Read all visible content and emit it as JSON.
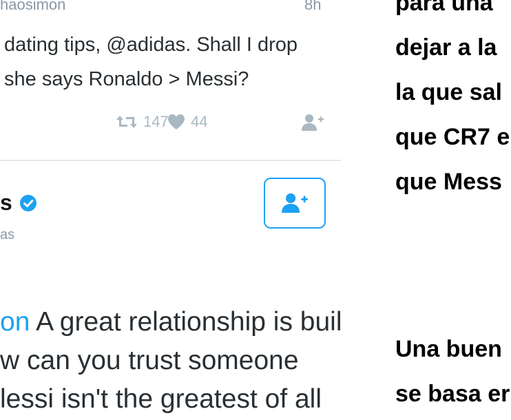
{
  "reply": {
    "handle": "haosimon",
    "time": "8h",
    "text_line1": "dating tips, @adidas. Shall I drop",
    "text_line2": "she says Ronaldo > Messi?",
    "retweet_count": "147",
    "like_count": "44"
  },
  "profile": {
    "name": "s",
    "handle": "as"
  },
  "tweet": {
    "mention": "on",
    "line1_rest": " A great relationship is built",
    "line2": "w can you trust someone",
    "line3": "lessi isn't the greatest of all"
  },
  "caption": {
    "lines": [
      "para una",
      "dejar a la",
      "la que sal",
      "que CR7 e",
      "que Mess",
      "Una buen",
      "se basa er"
    ]
  },
  "colors": {
    "accent": "#1da1f2",
    "icon_gray": "#aab8c2",
    "meta_gray": "#8899a6",
    "divider": "#e1e8ed"
  }
}
